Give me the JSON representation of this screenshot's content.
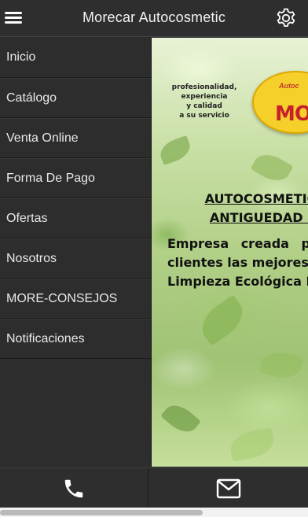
{
  "header": {
    "title": "Morecar Autocosmetic",
    "menu_icon": "hamburger-menu-icon",
    "settings_icon": "gear-icon"
  },
  "sidebar": {
    "items": [
      {
        "label": "Inicio"
      },
      {
        "label": "Catálogo"
      },
      {
        "label": "Venta Online"
      },
      {
        "label": "Forma De Pago"
      },
      {
        "label": "Ofertas"
      },
      {
        "label": "Nosotros"
      },
      {
        "label": "MORE-CONSEJOS"
      },
      {
        "label": "Notificaciones"
      }
    ]
  },
  "main": {
    "banner": {
      "slogan_lines": [
        "profesionalidad,",
        "experiencia",
        "y calidad",
        "a su servicio"
      ],
      "logo_small": "Autoc",
      "logo_text": "MORE"
    },
    "heading_lines": [
      "AUTOCOSMETIC MO",
      "ANTIGUEDAD EN LI"
    ],
    "body_lines": [
      "Empresa creada p",
      "clientes las mejores",
      "Limpieza Ecológica I"
    ]
  },
  "footer": {
    "phone_icon": "phone-icon",
    "mail_icon": "envelope-icon"
  },
  "colors": {
    "bar_bg": "#2e2e2e",
    "sidebar_bg": "#2d2d2d",
    "text_light": "#e8e8e8",
    "logo_yellow": "#f5cf2a",
    "logo_red": "#c8202b"
  }
}
